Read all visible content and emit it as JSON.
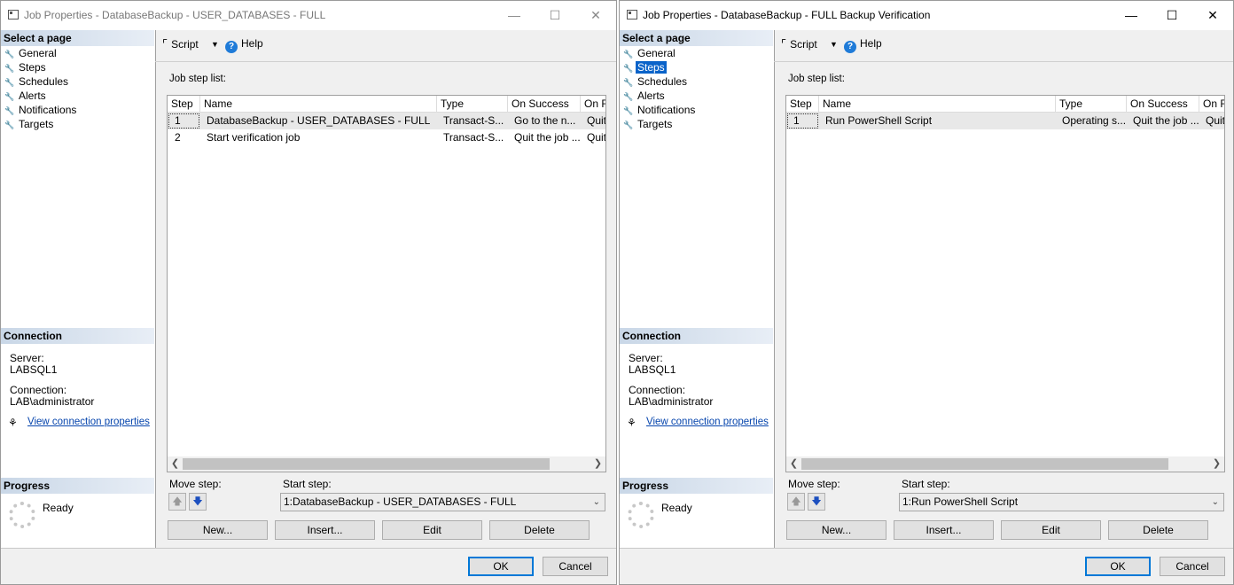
{
  "colors": {
    "selection": "#0a63c9",
    "link": "#0645ad",
    "default_button_border": "#0078d7"
  },
  "windows": [
    {
      "title": "Job Properties - DatabaseBackup - USER_DATABASES - FULL",
      "active": false,
      "select_page_header": "Select a page",
      "pages": [
        "General",
        "Steps",
        "Schedules",
        "Alerts",
        "Notifications",
        "Targets"
      ],
      "selected_page_index": -1,
      "connection_header": "Connection",
      "server_label": "Server:",
      "server_value": "LABSQL1",
      "connection_label": "Connection:",
      "connection_value": "LAB\\administrator",
      "view_connection_link": "View connection properties",
      "progress_header": "Progress",
      "progress_status": "Ready",
      "toolbar": {
        "script_label": "Script",
        "help_label": "Help"
      },
      "job_step_list_label": "Job step list:",
      "columns": [
        "Step",
        "Name",
        "Type",
        "On Success",
        "On F"
      ],
      "rows": [
        [
          "1",
          "DatabaseBackup - USER_DATABASES - FULL",
          "Transact-S...",
          "Go to the n...",
          "Quit"
        ],
        [
          "2",
          "Start verification job",
          "Transact-S...",
          "Quit the job ...",
          "Quit"
        ]
      ],
      "selected_row_index": 0,
      "move_step_label": "Move step:",
      "start_step_label": "Start step:",
      "start_step_value": "1:DatabaseBackup - USER_DATABASES - FULL",
      "buttons": {
        "new": "New...",
        "insert": "Insert...",
        "edit": "Edit",
        "delete": "Delete",
        "ok": "OK",
        "cancel": "Cancel"
      }
    },
    {
      "title": "Job Properties - DatabaseBackup - FULL Backup Verification",
      "active": true,
      "select_page_header": "Select a page",
      "pages": [
        "General",
        "Steps",
        "Schedules",
        "Alerts",
        "Notifications",
        "Targets"
      ],
      "selected_page_index": 1,
      "connection_header": "Connection",
      "server_label": "Server:",
      "server_value": "LABSQL1",
      "connection_label": "Connection:",
      "connection_value": "LAB\\administrator",
      "view_connection_link": "View connection properties",
      "progress_header": "Progress",
      "progress_status": "Ready",
      "toolbar": {
        "script_label": "Script",
        "help_label": "Help"
      },
      "job_step_list_label": "Job step list:",
      "columns": [
        "Step",
        "Name",
        "Type",
        "On Success",
        "On F"
      ],
      "rows": [
        [
          "1",
          "Run PowerShell Script",
          "Operating s...",
          "Quit the job ...",
          "Quit"
        ]
      ],
      "selected_row_index": 0,
      "move_step_label": "Move step:",
      "start_step_label": "Start step:",
      "start_step_value": "1:Run PowerShell Script",
      "buttons": {
        "new": "New...",
        "insert": "Insert...",
        "edit": "Edit",
        "delete": "Delete",
        "ok": "OK",
        "cancel": "Cancel"
      }
    }
  ]
}
